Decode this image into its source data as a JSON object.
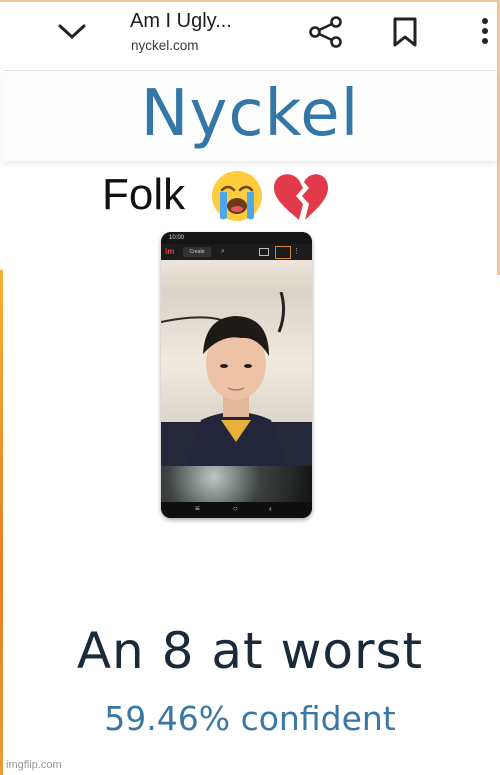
{
  "browser": {
    "page_title": "Am I Ugly...",
    "url": "nyckel.com",
    "icons": [
      "chevron-down-icon",
      "share-icon",
      "bookmark-icon",
      "more-vert-icon"
    ]
  },
  "site": {
    "logo_text": "Nyckel",
    "logo_color": "#3376a8"
  },
  "caption": {
    "text": "Folk",
    "emojis": [
      "loudly-crying-face-icon",
      "broken-heart-icon"
    ]
  },
  "phone_screenshot": {
    "status_time": "10:00",
    "app_logo": "im",
    "chip_label": "Create",
    "nav_icons": [
      "menu-icon",
      "home-icon",
      "back-icon"
    ]
  },
  "result": {
    "verdict": "An 8 at worst",
    "confidence": "59.46% confident",
    "verdict_color": "#1a2a3a",
    "confidence_color": "#3b77a3"
  },
  "watermark": "imgflip.com"
}
